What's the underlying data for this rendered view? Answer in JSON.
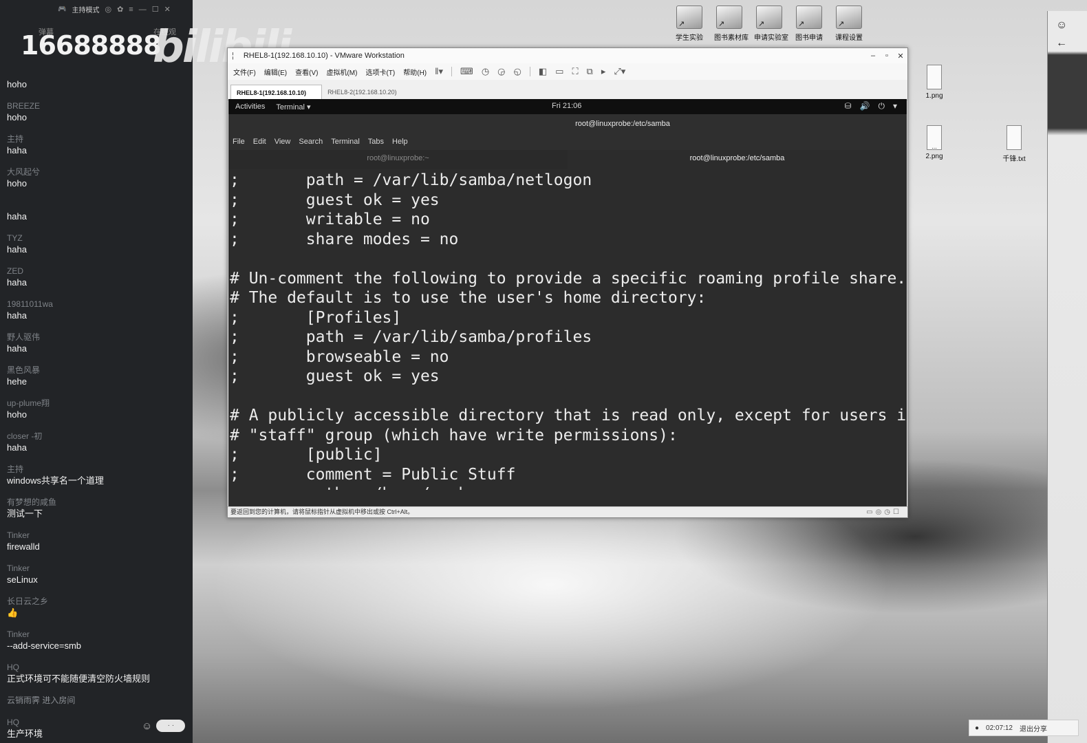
{
  "chat": {
    "header": {
      "mode": "主持模式"
    },
    "tabs": [
      "弹幕",
      "在线观"
    ],
    "watermark": {
      "number": "16688888",
      "logo": "bilibili"
    },
    "messages": [
      {
        "user": "",
        "text": "hoho"
      },
      {
        "user": "BREEZE",
        "text": "hoho"
      },
      {
        "user": "主持",
        "text": "haha"
      },
      {
        "user": "大风起兮",
        "text": "hoho"
      },
      {
        "user": "",
        "text": "haha"
      },
      {
        "user": "TYZ",
        "text": "haha"
      },
      {
        "user": "ZED",
        "text": "haha"
      },
      {
        "user": "19811011wa",
        "text": "haha"
      },
      {
        "user": "野人驱伟",
        "text": "haha"
      },
      {
        "user": "黑色风暴",
        "text": "hehe"
      },
      {
        "user": "up-plume翔",
        "text": "hoho"
      },
      {
        "user": "closer -初",
        "text": "haha"
      },
      {
        "user": "主持",
        "text": "windows共享名一个道理"
      },
      {
        "user": "有梦想的咸鱼",
        "text": "测试一下"
      },
      {
        "user": "Tinker",
        "text": "firewalld"
      },
      {
        "user": "Tinker",
        "text": "seLinux"
      },
      {
        "user": "长日云之乡",
        "text": "👍"
      },
      {
        "user": "Tinker",
        "text": "--add-service=smb"
      },
      {
        "user": "HQ",
        "text": "正式环境可不能随便清空防火墙规则"
      },
      {
        "user": "",
        "text": "云销雨霁 进入房间",
        "system": true
      },
      {
        "user": "HQ",
        "text": "生产环境"
      }
    ],
    "footer_button": "· ·"
  },
  "desktop": {
    "shortcuts": [
      "学生实验",
      "图书素材库",
      "申请实验室",
      "图书申请",
      "课程设置"
    ],
    "files": [
      "1.png",
      "2.png",
      "千锋.txt"
    ]
  },
  "vmware": {
    "title": "RHEL8-1(192.168.10.10) - VMware Workstation",
    "menu": [
      "文件(F)",
      "编辑(E)",
      "查看(V)",
      "虚拟机(M)",
      "选项卡(T)",
      "帮助(H)"
    ],
    "tabs": [
      "RHEL8-1(192.168.10.10)",
      "RHEL8-2(192.168.10.20)"
    ],
    "status": "要返回到您的计算机，请将鼠标指针从虚拟机中移出或按 Ctrl+Alt。"
  },
  "gnome": {
    "activities": "Activities",
    "app": "Terminal ▾",
    "clock": "Fri 21:06"
  },
  "terminal": {
    "title": "root@linuxprobe:/etc/samba",
    "menu": [
      "File",
      "Edit",
      "View",
      "Search",
      "Terminal",
      "Tabs",
      "Help"
    ],
    "tabs": [
      "root@linuxprobe:~",
      "root@linuxprobe:/etc/samba"
    ],
    "lines": [
      ";       path = /var/lib/samba/netlogon",
      ";       guest ok = yes",
      ";       writable = no",
      ";       share modes = no",
      "",
      "# Un-comment the following to provide a specific roaming profile share.",
      "# The default is to use the user's home directory:",
      ";       [Profiles]",
      ";       path = /var/lib/samba/profiles",
      ";       browseable = no",
      ";       guest ok = yes",
      "",
      "# A publicly accessible directory that is read only, except for users in the",
      "# \"staff\" group (which have write permissions):",
      ";       [public]",
      ";       comment = Public Stuff",
      ";       path = /home/samba"
    ]
  },
  "share_bar": {
    "time": "02:07:12",
    "exit": "退出分享"
  }
}
